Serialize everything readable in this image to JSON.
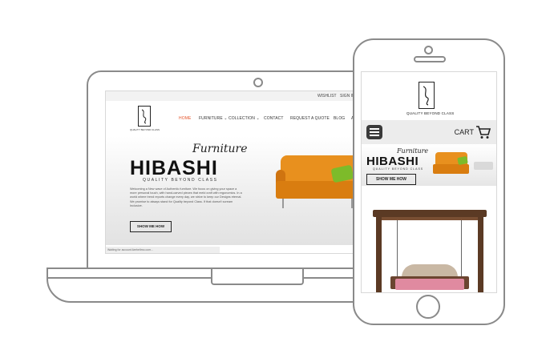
{
  "laptop": {
    "topbar": {
      "wishlist": "WISHLIST",
      "signin": "SIGN IN"
    },
    "logo_tagline": "QUALITY BEYOND CLASS",
    "nav": [
      {
        "label": "HOME",
        "active": true
      },
      {
        "label": "FURNITURE ⌄",
        "active": false
      },
      {
        "label": "COLLECTION ⌄",
        "active": false
      },
      {
        "label": "CONTACT",
        "active": false
      },
      {
        "label": "REQUEST A QUOTE",
        "active": false
      },
      {
        "label": "BLOG",
        "active": false
      },
      {
        "label": "A",
        "active": false
      }
    ],
    "hero": {
      "title": "HIBASHI",
      "script": "Furniture",
      "subtitle": "QUALITY BEYOND CLASS",
      "body": "Welcoming a New wave of Authentic furniture. We focus on giving your space a more personal touch, with hand-carved pieces that meld craft with ergonomics. In a world where trend reports change every day, we strive to keep our Designs eternal. We promise to always stand for Quality beyond Class. If that doesn't scream Inclusive.",
      "button": "SHOW ME HOW"
    },
    "status_text": "Waiting for account.lizeheltmo.com..."
  },
  "phone": {
    "logo_tagline": "QUALITY BEYOND CLASS",
    "cart_label": "CART",
    "hero": {
      "title": "HIBASHI",
      "script": "Furniture",
      "subtitle": "QUALITY BEYOND CLASS",
      "button": "SHOW ME HOW"
    }
  },
  "colors": {
    "accent": "#e5542a",
    "sofa": "#e8901e",
    "pillow": "#7dbb2a",
    "device_outline": "#8a8a8a"
  },
  "icons": {
    "menu": "hamburger-menu-icon",
    "cart": "shopping-cart-icon",
    "logo": "hibashi-logo-icon"
  }
}
